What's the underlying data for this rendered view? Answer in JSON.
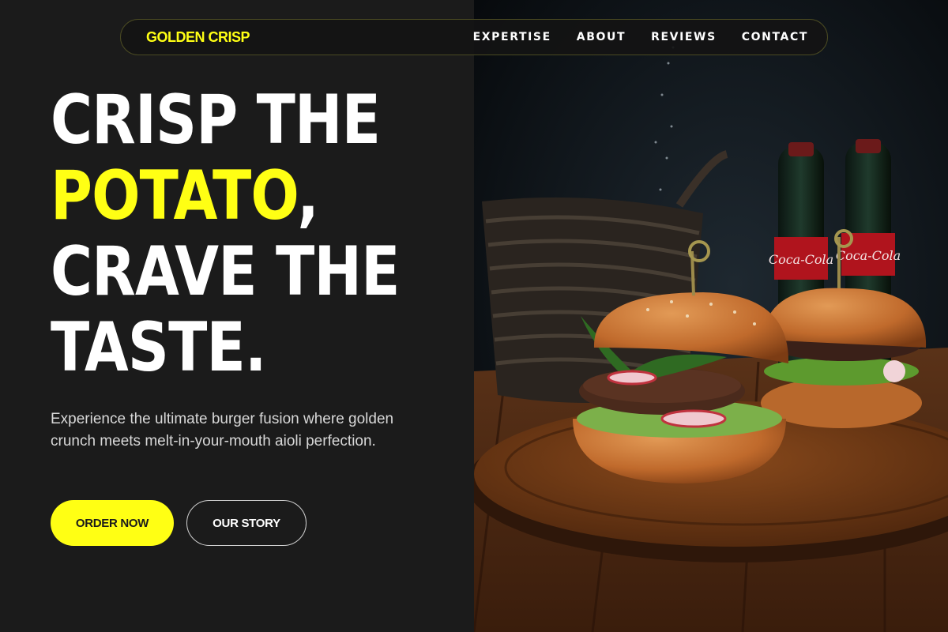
{
  "nav": {
    "brand": "GOLDEN CRISP",
    "links": [
      {
        "label": "EXPERTISE"
      },
      {
        "label": "ABOUT"
      },
      {
        "label": "REVIEWS"
      },
      {
        "label": "CONTACT"
      }
    ]
  },
  "hero": {
    "headline": {
      "line1": "CRISP THE",
      "line2_accent": "POTATO",
      "line2_rest": ",",
      "line3": "CRAVE THE",
      "line4": "TASTE."
    },
    "subtext": "Experience the ultimate burger fusion where golden crunch meets melt-in-your-mouth aioli perfection.",
    "buttons": {
      "primary": "ORDER NOW",
      "secondary": "OUR STORY"
    },
    "image": {
      "bottle_label": "Coca-Cola"
    }
  },
  "colors": {
    "accent": "#ffff14",
    "background": "#1b1b1b",
    "text": "#ffffff",
    "muted_text": "#d8d8d8"
  }
}
